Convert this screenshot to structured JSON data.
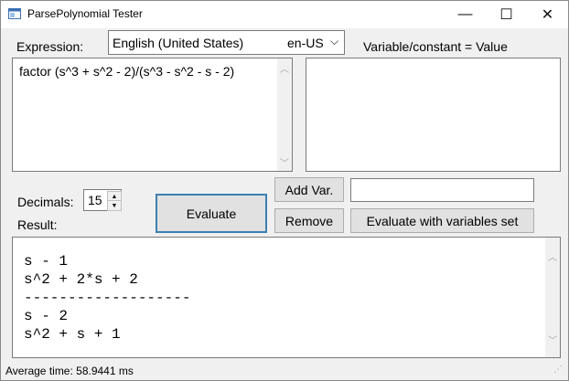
{
  "window": {
    "title": "ParsePolynomial Tester",
    "controls": {
      "minimize": "—",
      "maximize": "☐",
      "close": "✕"
    }
  },
  "expression": {
    "label": "Expression:",
    "value": "factor (s^3 + s^2 - 2)/(s^3 - s^2 - s - 2)"
  },
  "culture": {
    "selected_name": "English (United States)",
    "selected_code": "en-US"
  },
  "variables": {
    "header": "Variable/constant  = Value",
    "new_var_value": ""
  },
  "decimals": {
    "label": "Decimals:",
    "value": "15"
  },
  "result": {
    "label": "Result:",
    "lines": [
      "s - 1",
      "s^2 + 2*s + 2",
      "-------------------",
      "s - 2",
      "s^2 + s + 1"
    ]
  },
  "buttons": {
    "evaluate": "Evaluate",
    "add_var": "Add Var.",
    "remove": "Remove",
    "evaluate_with_vars": "Evaluate with variables set"
  },
  "status": {
    "text": "Average time: 58.9441 ms"
  },
  "colors": {
    "focus_border": "#3c7fb1",
    "accent": "#0078d7"
  }
}
